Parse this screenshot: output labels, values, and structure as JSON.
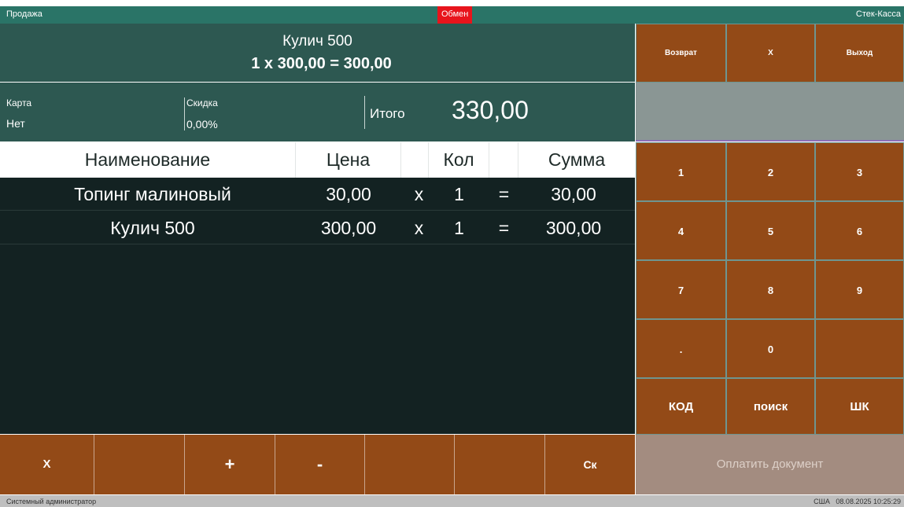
{
  "topbar": {
    "mode": "Продажа",
    "badge": "Обмен",
    "app_name": "Стек-Касса"
  },
  "current_item": {
    "name": "Кулич 500",
    "calc": "1 x 300,00 = 300,00"
  },
  "summary": {
    "card_label": "Карта",
    "card_value": "Нет",
    "discount_label": "Скидка",
    "discount_value": "0,00%",
    "total_label": "Итого",
    "total_value": "330,00"
  },
  "grid": {
    "headers": {
      "name": "Наименование",
      "price": "Цена",
      "qty": "Кол",
      "sum": "Сумма"
    },
    "rows": [
      {
        "name": "Топинг малиновый",
        "price": "30,00",
        "x": "x",
        "qty": "1",
        "eq": "=",
        "sum": "30,00"
      },
      {
        "name": "Кулич 500",
        "price": "300,00",
        "x": "x",
        "qty": "1",
        "eq": "=",
        "sum": "300,00"
      }
    ]
  },
  "numpad": {
    "top": {
      "return": "Возврат",
      "x": "X",
      "exit": "Выход"
    },
    "digits": {
      "d1": "1",
      "d2": "2",
      "d3": "3",
      "d4": "4",
      "d5": "5",
      "d6": "6",
      "d7": "7",
      "d8": "8",
      "d9": "9",
      "dot": ".",
      "d0": "0"
    },
    "bottom": {
      "code": "КОД",
      "search": "поиск",
      "barcode": "ШК"
    }
  },
  "bottombar": {
    "delete": "X",
    "plus": "+",
    "minus": "-",
    "discount": "Ск"
  },
  "pay_button": "Оплатить документ",
  "statusbar": {
    "user": "Системный администратор",
    "region": "США",
    "datetime": "08.08.2025 10:25:29"
  }
}
